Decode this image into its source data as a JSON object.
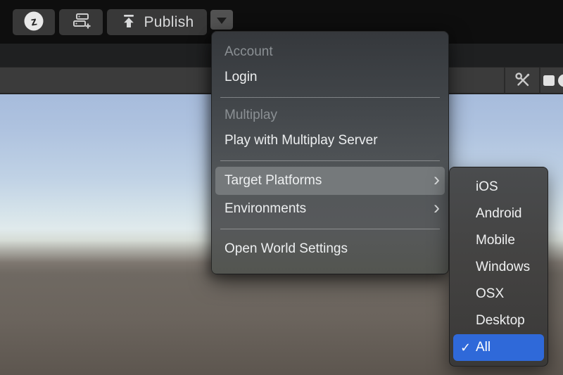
{
  "toolbar": {
    "publish_label": "Publish"
  },
  "menu": {
    "sections": [
      {
        "header": "Account",
        "items": [
          {
            "label": "Login"
          }
        ]
      },
      {
        "header": "Multiplay",
        "items": [
          {
            "label": "Play with Multiplay Server"
          }
        ]
      },
      {
        "items": [
          {
            "label": "Target Platforms",
            "has_submenu": true,
            "highlighted": true
          },
          {
            "label": "Environments",
            "has_submenu": true
          }
        ]
      },
      {
        "items": [
          {
            "label": "Open World Settings"
          }
        ]
      }
    ]
  },
  "submenu": {
    "items": [
      {
        "label": "iOS"
      },
      {
        "label": "Android"
      },
      {
        "label": "Mobile"
      },
      {
        "label": "Windows"
      },
      {
        "label": "OSX"
      },
      {
        "label": "Desktop"
      },
      {
        "label": "All",
        "checked": true,
        "selected": true
      }
    ]
  },
  "icons": {
    "chevron_right": "›",
    "checkmark": "✓"
  },
  "colors": {
    "selection_blue": "#2f69d9",
    "menu_highlight": "#75797b",
    "toolbar_button_bg": "#383838",
    "strip_bg": "#3b3b3b"
  }
}
